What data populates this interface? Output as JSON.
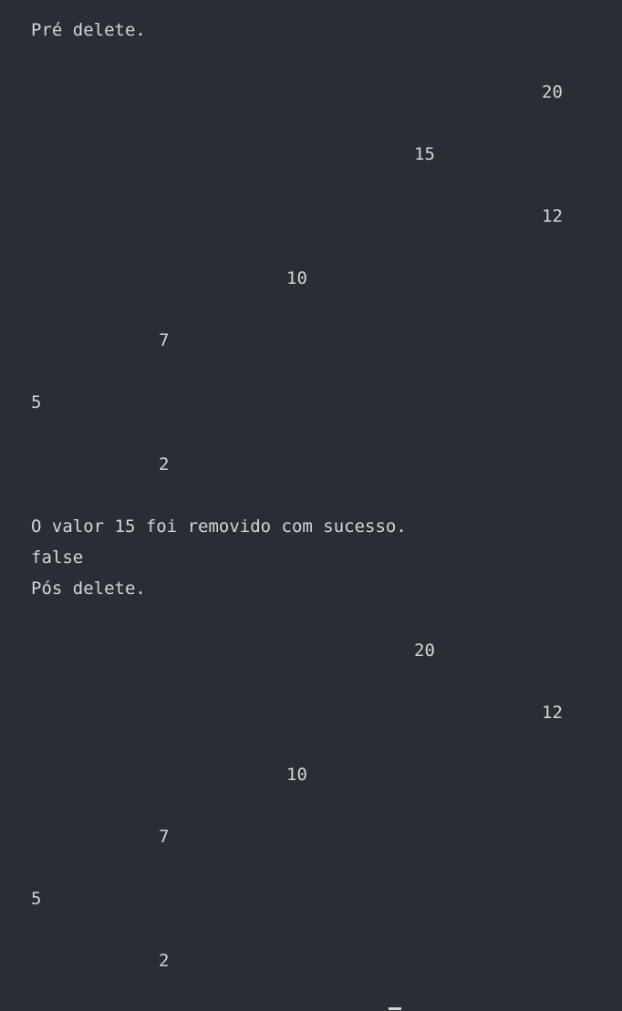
{
  "terminal": {
    "header_pre": "Pré delete.",
    "tree_pre": [
      "20",
      "15",
      "12",
      "10",
      "7",
      "5",
      "2"
    ],
    "removed_message": "O valor 15 foi removido com sucesso.",
    "result": "false",
    "header_post": "Pós delete.",
    "tree_post": [
      "20",
      "12",
      "10",
      "7",
      "5",
      "2"
    ]
  }
}
